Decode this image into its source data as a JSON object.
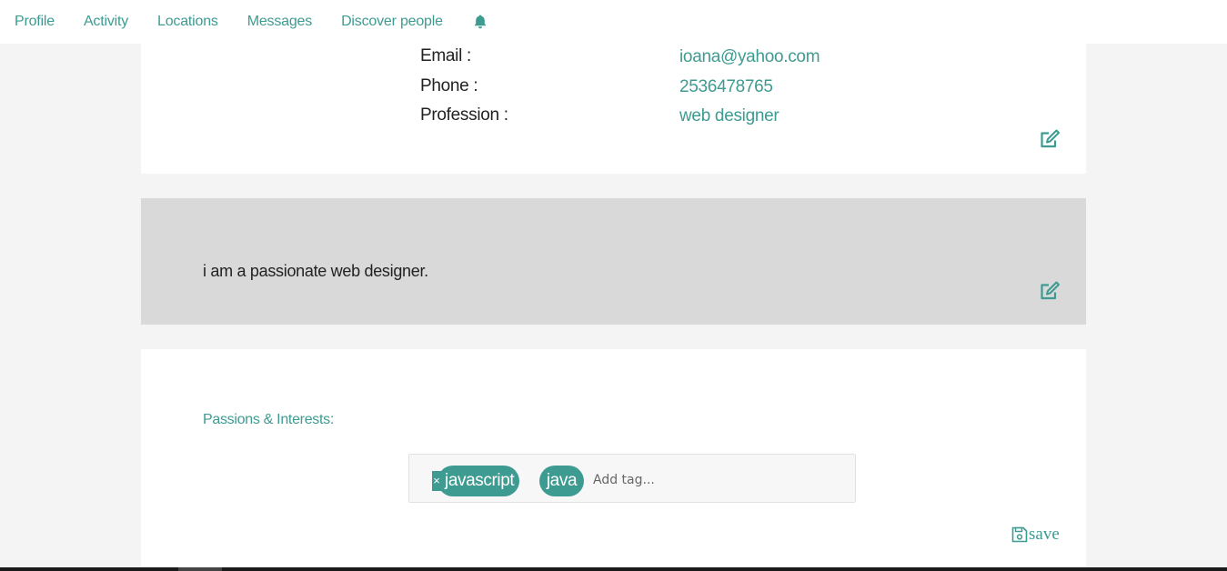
{
  "nav": {
    "items": [
      {
        "label": "Profile"
      },
      {
        "label": "Activity"
      },
      {
        "label": "Locations"
      },
      {
        "label": "Messages"
      },
      {
        "label": "Discover people"
      }
    ],
    "notification_icon": "bell-icon"
  },
  "info": {
    "email_label": "Email :",
    "email_value": "ioana@yahoo.com",
    "phone_label": "Phone :",
    "phone_value": "2536478765",
    "profession_label": "Profession :",
    "profession_value": "web designer",
    "edit_icon": "edit-icon"
  },
  "about": {
    "text": "i am a passionate web designer.",
    "edit_icon": "edit-icon"
  },
  "passions": {
    "label": "Passions & Interests:",
    "tags": [
      {
        "label": "javascript"
      },
      {
        "label": "java"
      }
    ],
    "remove_symbol": "×",
    "input_placeholder": "Add tag...",
    "save_label": "save",
    "save_icon": "floppy-disk-icon"
  },
  "colors": {
    "accent": "#3e9b91",
    "background": "#f4f4f4",
    "about_background": "#d9d9d9"
  }
}
